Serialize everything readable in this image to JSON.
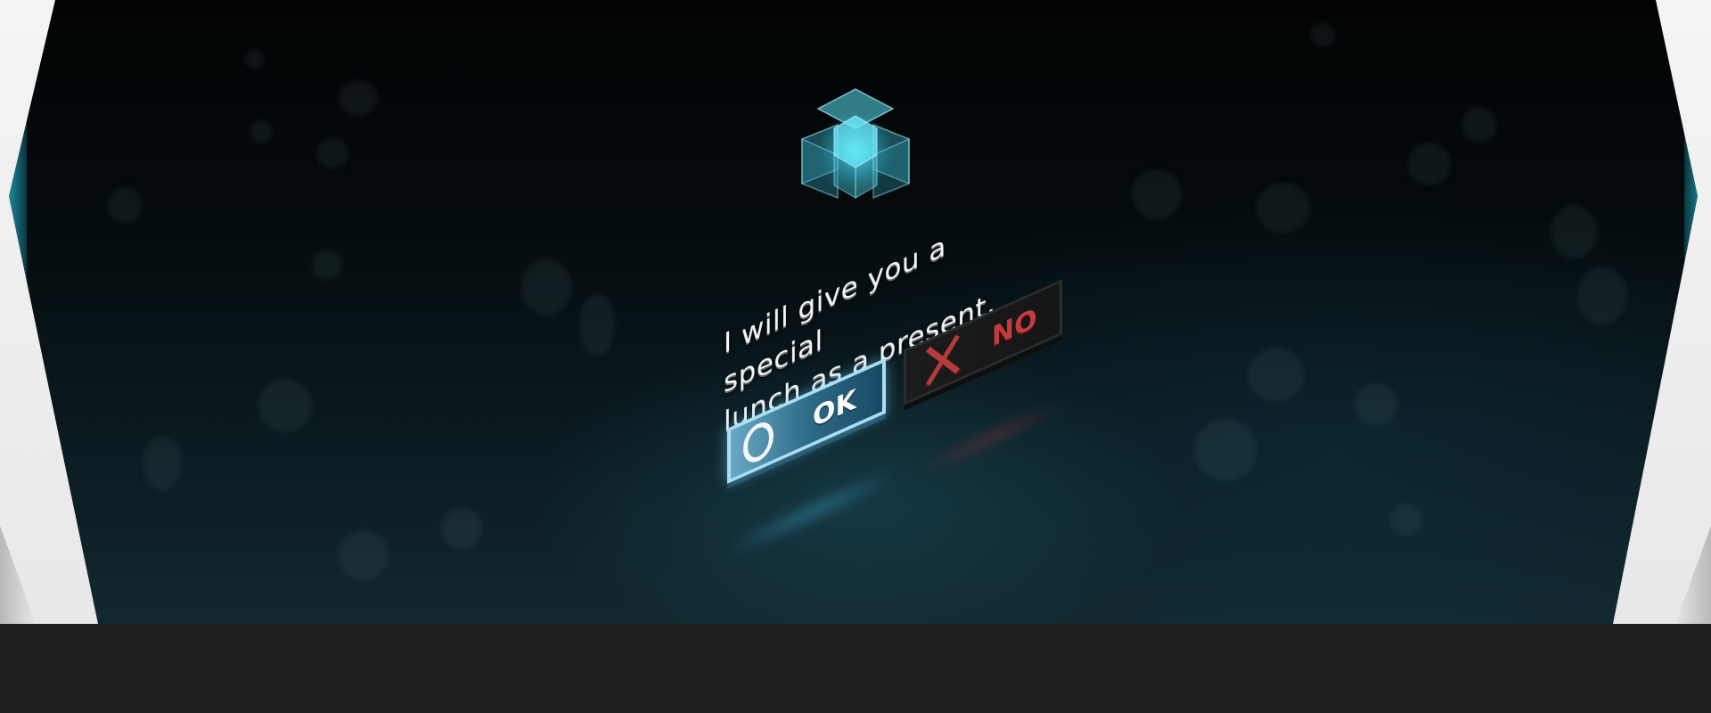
{
  "dialog": {
    "message_line_1": "I will give you a special",
    "message_line_2": "lunch as a present.",
    "ok_label": "OK",
    "no_label": "NO"
  },
  "icons": {
    "logo": "glowing-cube-icon",
    "confirm": "circle-icon",
    "cancel": "x-icon"
  },
  "colors": {
    "accent": "#3fc9e6",
    "ok_fill": "#2f6c88",
    "ok_border": "#a9dff4",
    "no_text": "#c23c3c",
    "background": "#04090b"
  }
}
